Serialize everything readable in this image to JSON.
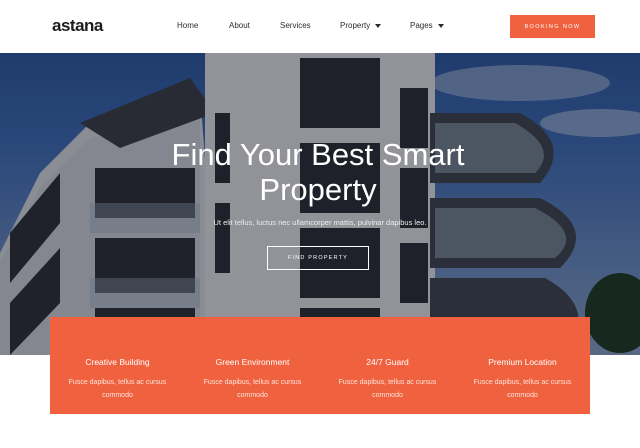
{
  "brand": {
    "logo": "astana",
    "accent_color": "#f0623f"
  },
  "nav": {
    "items": [
      {
        "label": "Home"
      },
      {
        "label": "About"
      },
      {
        "label": "Services"
      },
      {
        "label": "Property"
      },
      {
        "label": "Pages"
      }
    ],
    "cta_label": "BOOKING NOW"
  },
  "hero": {
    "title_line1": "Find Your Best Smart",
    "title_line2": "Property",
    "subtitle": "Ut elit tellus, luctus nec ullamcorper mattis, pulvinar dapibus leo.",
    "button_label": "FIND PROPERTY"
  },
  "features": [
    {
      "title": "Creative Building",
      "desc": "Fusce dapibus, tellus ac cursus commodo"
    },
    {
      "title": "Green Environment",
      "desc": "Fusce dapibus, tellus ac cursus commodo"
    },
    {
      "title": "24/7 Guard",
      "desc": "Fusce dapibus, tellus ac cursus commodo"
    },
    {
      "title": "Premium Location",
      "desc": "Fusce dapibus, tellus ac cursus commodo"
    }
  ]
}
